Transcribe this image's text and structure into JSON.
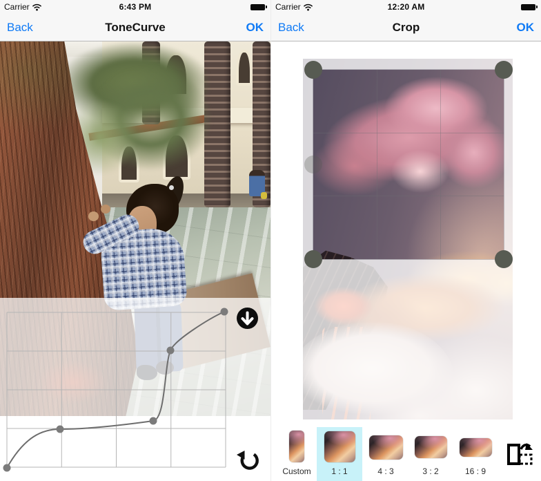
{
  "tonecurve_screen": {
    "status": {
      "carrier": "Carrier",
      "time": "6:43 PM",
      "icons": [
        "wifi-icon",
        "battery-icon"
      ]
    },
    "nav": {
      "back": "Back",
      "title": "ToneCurve",
      "ok": "OK"
    },
    "curve": {
      "grid_rows": 4,
      "grid_cols": 4,
      "points_norm": [
        [
          0.0,
          0.0
        ],
        [
          0.24,
          0.25
        ],
        [
          0.67,
          0.3
        ],
        [
          0.75,
          0.75
        ],
        [
          1.0,
          1.0
        ]
      ],
      "apply_icon": "download-apply-icon",
      "reset_icon": "undo-reset-icon"
    }
  },
  "crop_screen": {
    "status": {
      "carrier": "Carrier",
      "time": "12:20 AM",
      "icons": [
        "wifi-icon",
        "battery-icon"
      ]
    },
    "nav": {
      "back": "Back",
      "title": "Crop",
      "ok": "OK"
    },
    "aspect_options": [
      {
        "label": "Custom",
        "selected": false
      },
      {
        "label": "1 : 1",
        "selected": true
      },
      {
        "label": "4 : 3",
        "selected": false
      },
      {
        "label": "3 : 2",
        "selected": false
      },
      {
        "label": "16 : 9",
        "selected": false
      }
    ],
    "rotate_icon": "rotate-crop-icon",
    "crop_handles": 4
  },
  "colors": {
    "accent_blue": "#0f7af5",
    "bar_background": "#f7f7f7",
    "selected_ratio_background": "#c8f2f9",
    "crop_handle": "#575b52",
    "overlay_wash": "rgba(255,255,255,0.76)"
  }
}
